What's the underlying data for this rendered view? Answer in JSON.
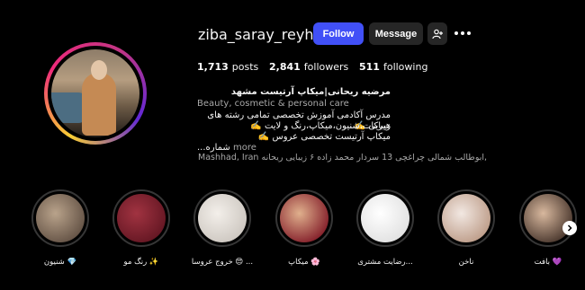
{
  "profile": {
    "username": "ziba_saray_reyhane",
    "follow_label": "Follow",
    "message_label": "Message",
    "add_user_icon": "add-user-icon",
    "more_icon": "more-options-icon"
  },
  "stats": {
    "posts_count": "1,713",
    "posts_label": "posts",
    "followers_count": "2,841",
    "followers_label": "followers",
    "following_count": "511",
    "following_label": "following"
  },
  "bio": {
    "name": "مرضیه ریحانی|میکاپ آرتیست مشهد",
    "category": "Beauty, cosmetic & personal care",
    "line1": "مدرس آکادمی آموزش تخصصی تمامی رشته های زیبایی ✍️",
    "line2": "هیرکات،شنیون،میکاپ،رنگ و لایت ✍️",
    "line3": "میکاپ آرتیست تخصصی عروس ✍️",
    "line4": "شماره...",
    "more_label": "more",
    "location": "Mashhad, Iran ابوطالب شمالی چراغچی 13 سردار محمد زاده ۶ زیبایی ریحانه,"
  },
  "highlights": [
    {
      "label": "شنیون 💎",
      "colors": [
        "#5b4a3e",
        "#b9a38b"
      ]
    },
    {
      "label": "رنگ مو ✨",
      "colors": [
        "#5e1420",
        "#a13341"
      ]
    },
    {
      "label": "خروج عروسا 😍 ...",
      "colors": [
        "#c9c3bc",
        "#f3efea"
      ]
    },
    {
      "label": "میکاپ 🌸",
      "colors": [
        "#7a1020",
        "#e0b08d"
      ]
    },
    {
      "label": "رضایت مشتری...",
      "colors": [
        "#dedede",
        "#ffffff"
      ]
    },
    {
      "label": "ناخن",
      "colors": [
        "#b89580",
        "#f2e8e2"
      ]
    },
    {
      "label": "بافت 💜",
      "colors": [
        "#3b2a22",
        "#d8b89e"
      ]
    }
  ],
  "colors": {
    "follow_button": "#4150f7",
    "secondary_button": "#262626",
    "muted_text": "#a8a8a8"
  }
}
